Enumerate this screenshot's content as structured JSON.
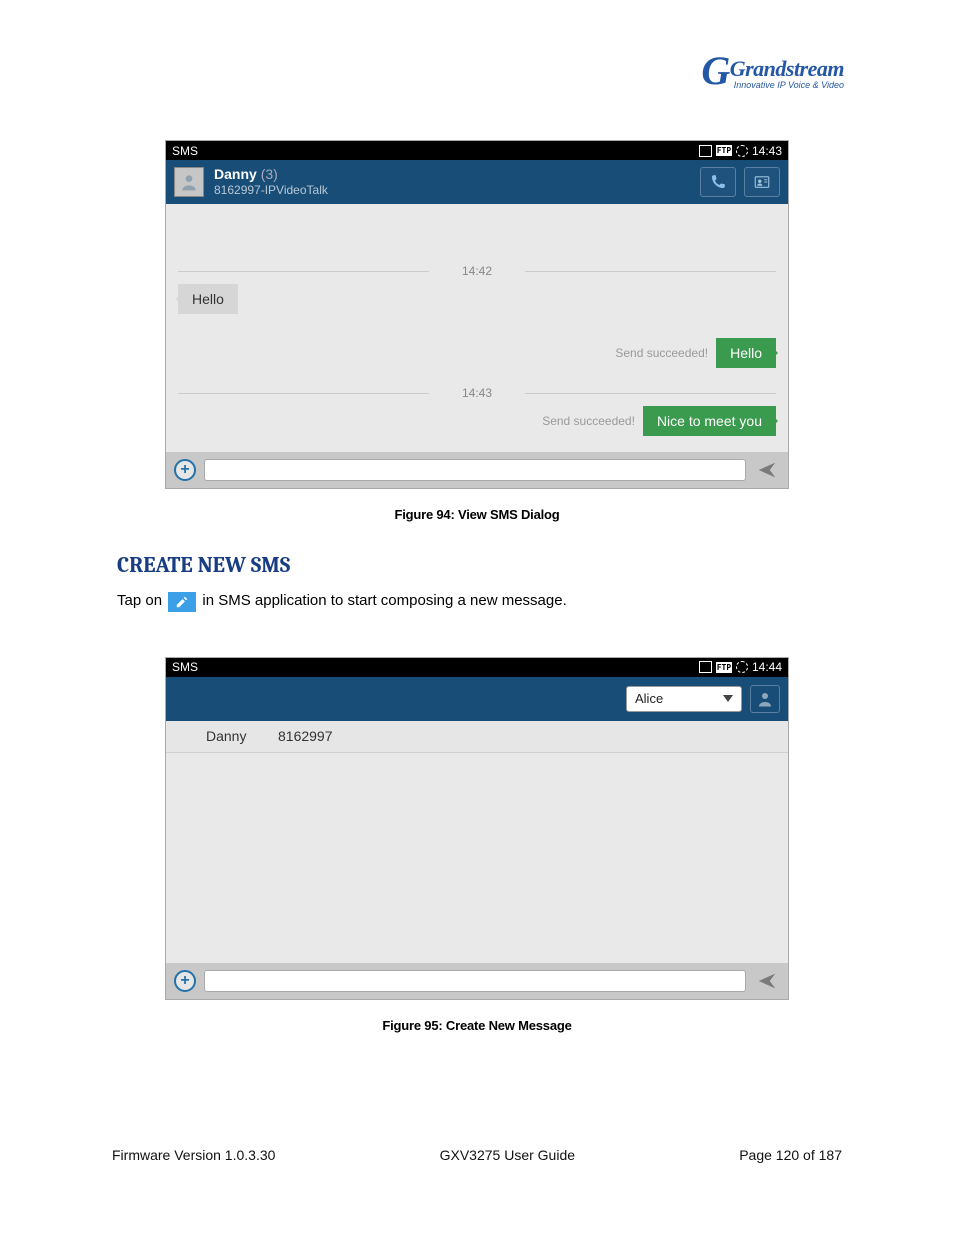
{
  "logo": {
    "brand": "Grandstream",
    "tagline": "Innovative IP Voice & Video"
  },
  "fig94": {
    "caption": "Figure 94: View SMS Dialog",
    "statusbar": {
      "title": "SMS",
      "time": "14:43"
    },
    "header": {
      "name": "Danny",
      "count": "(3)",
      "sub": "8162997-IPVideoTalk"
    },
    "sep1": "14:42",
    "msg_in_1": "Hello",
    "sep2": "14:43",
    "row_out_1_status": "Send succeeded!",
    "row_out_1_text": "Hello",
    "row_out_2_status": "Send succeeded!",
    "row_out_2_text": "Nice to meet you"
  },
  "section_heading": "CREATE NEW SMS",
  "para": {
    "pre": "Tap on ",
    "post": " in SMS application to start composing a new message."
  },
  "fig95": {
    "caption": "Figure 95: Create New Message",
    "statusbar": {
      "title": "SMS",
      "time": "14:44"
    },
    "recipient": "Alice",
    "match": {
      "name": "Danny",
      "number": "8162997"
    }
  },
  "footer": {
    "left": "Firmware Version 1.0.3.30",
    "center": "GXV3275 User Guide",
    "right": "Page 120 of 187"
  }
}
